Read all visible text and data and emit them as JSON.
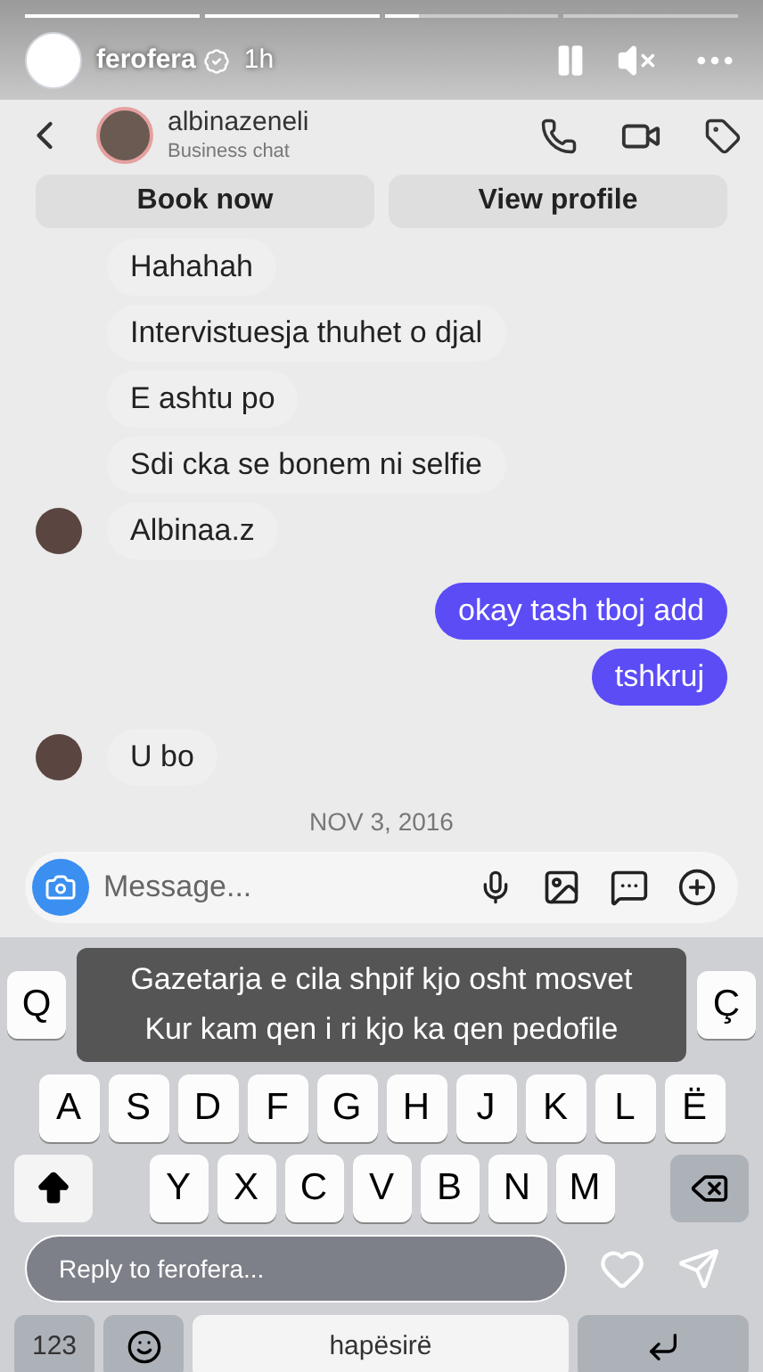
{
  "story": {
    "progress": [
      {
        "level": 1
      },
      {
        "level": 1
      },
      {
        "level": 0.2
      },
      {
        "level": 0
      }
    ],
    "user": {
      "name": "ferofera",
      "verified": true,
      "time": "1h"
    },
    "paused": false,
    "muted": true
  },
  "chat_header": {
    "name": "albinazeneli",
    "subtitle": "Business chat",
    "buttons": [
      "Book now",
      "View profile"
    ]
  },
  "messages": [
    {
      "kind": "incoming",
      "text": "Hahahah",
      "avatar": false
    },
    {
      "kind": "incoming",
      "text": "Intervistuesja thuhet o djal",
      "avatar": false
    },
    {
      "kind": "incoming",
      "text": "E ashtu po",
      "avatar": false
    },
    {
      "kind": "incoming",
      "text": "Sdi cka se bonem ni selfie",
      "avatar": false
    },
    {
      "kind": "incoming",
      "text": "Albinaa.z",
      "avatar": true
    },
    {
      "kind": "outgoing",
      "text": "okay tash tboj add"
    },
    {
      "kind": "outgoing",
      "text": "tshkruj"
    },
    {
      "kind": "incoming",
      "text": "U bo",
      "avatar": true
    }
  ],
  "date": "NOV 3, 2016",
  "composer": {
    "placeholder": "Message..."
  },
  "caption": [
    "Gazetarja e cila shpif kjo osht mosvet",
    "Kur kam qen i ri kjo ka qen pedofile"
  ],
  "keyboard": {
    "row_1_visible": [
      "Q",
      "Ç"
    ],
    "row_2": [
      "A",
      "S",
      "D",
      "F",
      "G",
      "H",
      "J",
      "K",
      "L",
      "Ë"
    ],
    "row_3": [
      "Y",
      "X",
      "C",
      "V",
      "B",
      "N",
      "M"
    ],
    "numbers_key": "123",
    "space_key": "hapësirë"
  },
  "reply": {
    "placeholder": "Reply to ferofera..."
  }
}
